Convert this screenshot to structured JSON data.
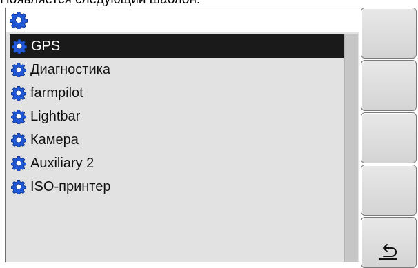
{
  "caption": "Появляется следующий шаблон:",
  "menu": {
    "items": [
      {
        "label": "GPS",
        "selected": true
      },
      {
        "label": "Диагностика",
        "selected": false
      },
      {
        "label": "farmpilot",
        "selected": false
      },
      {
        "label": "Lightbar",
        "selected": false
      },
      {
        "label": "Камера",
        "selected": false
      },
      {
        "label": "Auxiliary 2",
        "selected": false
      },
      {
        "label": "ISO-принтер",
        "selected": false
      }
    ]
  },
  "softkeys": [
    {
      "icon": ""
    },
    {
      "icon": ""
    },
    {
      "icon": ""
    },
    {
      "icon": ""
    },
    {
      "icon": "return-arrow-icon"
    }
  ],
  "colors": {
    "gear_icon": "#1f57d6",
    "selection": "#1a1a1a",
    "panel_bg": "#e2e2e2"
  }
}
